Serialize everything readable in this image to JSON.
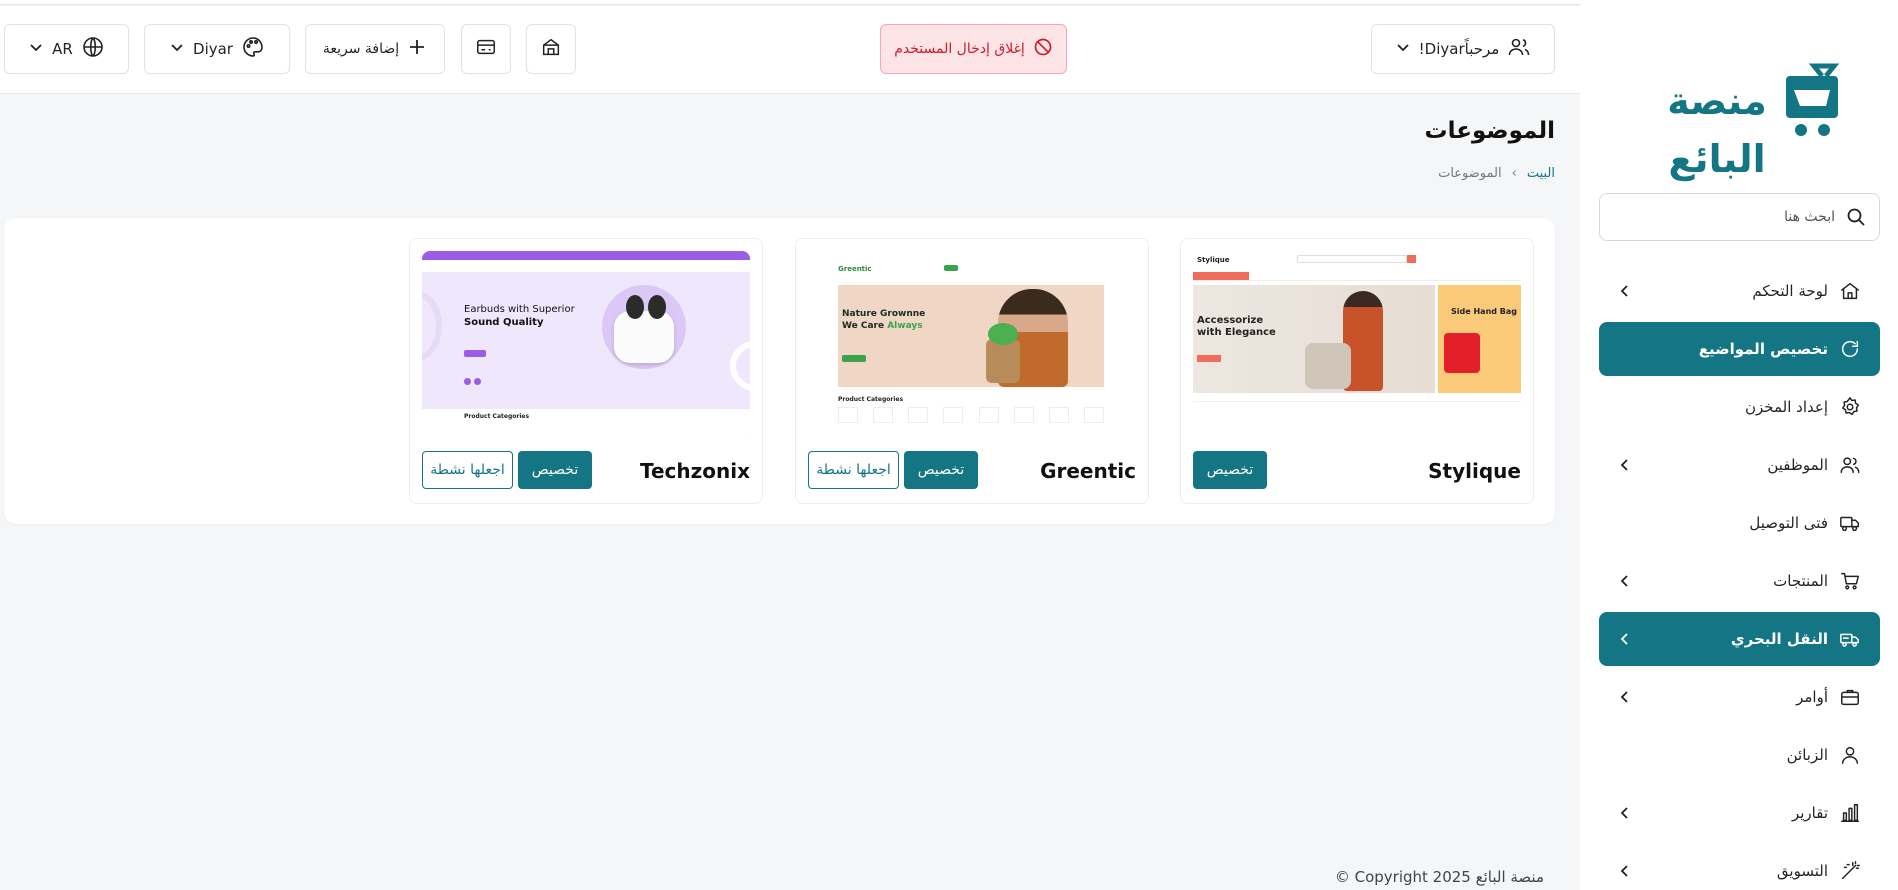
{
  "brand": {
    "logo_text": "منصة البائع"
  },
  "search": {
    "placeholder": "ابحث هنا"
  },
  "sidebar": {
    "items": [
      {
        "label": "لوحة التحكم",
        "icon": "home-icon",
        "has_chevron": true,
        "active": false
      },
      {
        "label": "تخصيص المواضيع",
        "icon": "refresh-icon",
        "has_chevron": false,
        "active": true
      },
      {
        "label": "إعداد المخزن",
        "icon": "gear-icon",
        "has_chevron": false,
        "active": false
      },
      {
        "label": "الموظفين",
        "icon": "users-icon",
        "has_chevron": true,
        "active": false
      },
      {
        "label": "فتى التوصيل",
        "icon": "truck-icon",
        "has_chevron": false,
        "active": false
      },
      {
        "label": "المنتجات",
        "icon": "cart-icon",
        "has_chevron": true,
        "active": false
      },
      {
        "label": "النقل البحري",
        "icon": "shipping-icon",
        "has_chevron": true,
        "active": true
      },
      {
        "label": "أوامر",
        "icon": "briefcase-icon",
        "has_chevron": true,
        "active": false
      },
      {
        "label": "الزبائن",
        "icon": "user-icon",
        "has_chevron": false,
        "active": false
      },
      {
        "label": "تقارير",
        "icon": "chart-icon",
        "has_chevron": true,
        "active": false
      },
      {
        "label": "التسويق",
        "icon": "magic-icon",
        "has_chevron": true,
        "active": false
      }
    ]
  },
  "header": {
    "user_greeting": "مرحباًDiyar!",
    "logout_label": "إغلاق إدخال المستخدم",
    "quick_add_label": "إضافة سريعة",
    "theme_label": "Diyar",
    "lang_label": "AR"
  },
  "page": {
    "title": "الموضوعات",
    "breadcrumb": {
      "home": "البيت",
      "separator": "‹",
      "current": "الموضوعات"
    }
  },
  "themes": [
    {
      "name": "Stylique",
      "customize_label": "تخصيص",
      "activate_label": "",
      "preview": {
        "hero_text": "Accessorize with Elegance",
        "side_text": "Side Hand Bag",
        "logo": "Stylique"
      }
    },
    {
      "name": "Greentic",
      "customize_label": "تخصيص",
      "activate_label": "اجعلها نشطة",
      "preview": {
        "hero_line1": "Nature Grownne",
        "hero_line2_a": "We Care ",
        "hero_line2_b": "Always",
        "section": "Product Categories",
        "logo": "Greentic"
      }
    },
    {
      "name": "Techzonix",
      "customize_label": "تخصيص",
      "activate_label": "اجعلها نشطة",
      "preview": {
        "hero_line1": "Earbuds with Superior",
        "hero_line2": "Sound Quality",
        "section": "Product Categories"
      }
    }
  ],
  "footer": {
    "copyright": "© Copyright 2025 منصة البائع"
  },
  "colors": {
    "accent": "#147685",
    "danger": "#d11a2a",
    "danger_bg": "#fde4e6"
  }
}
